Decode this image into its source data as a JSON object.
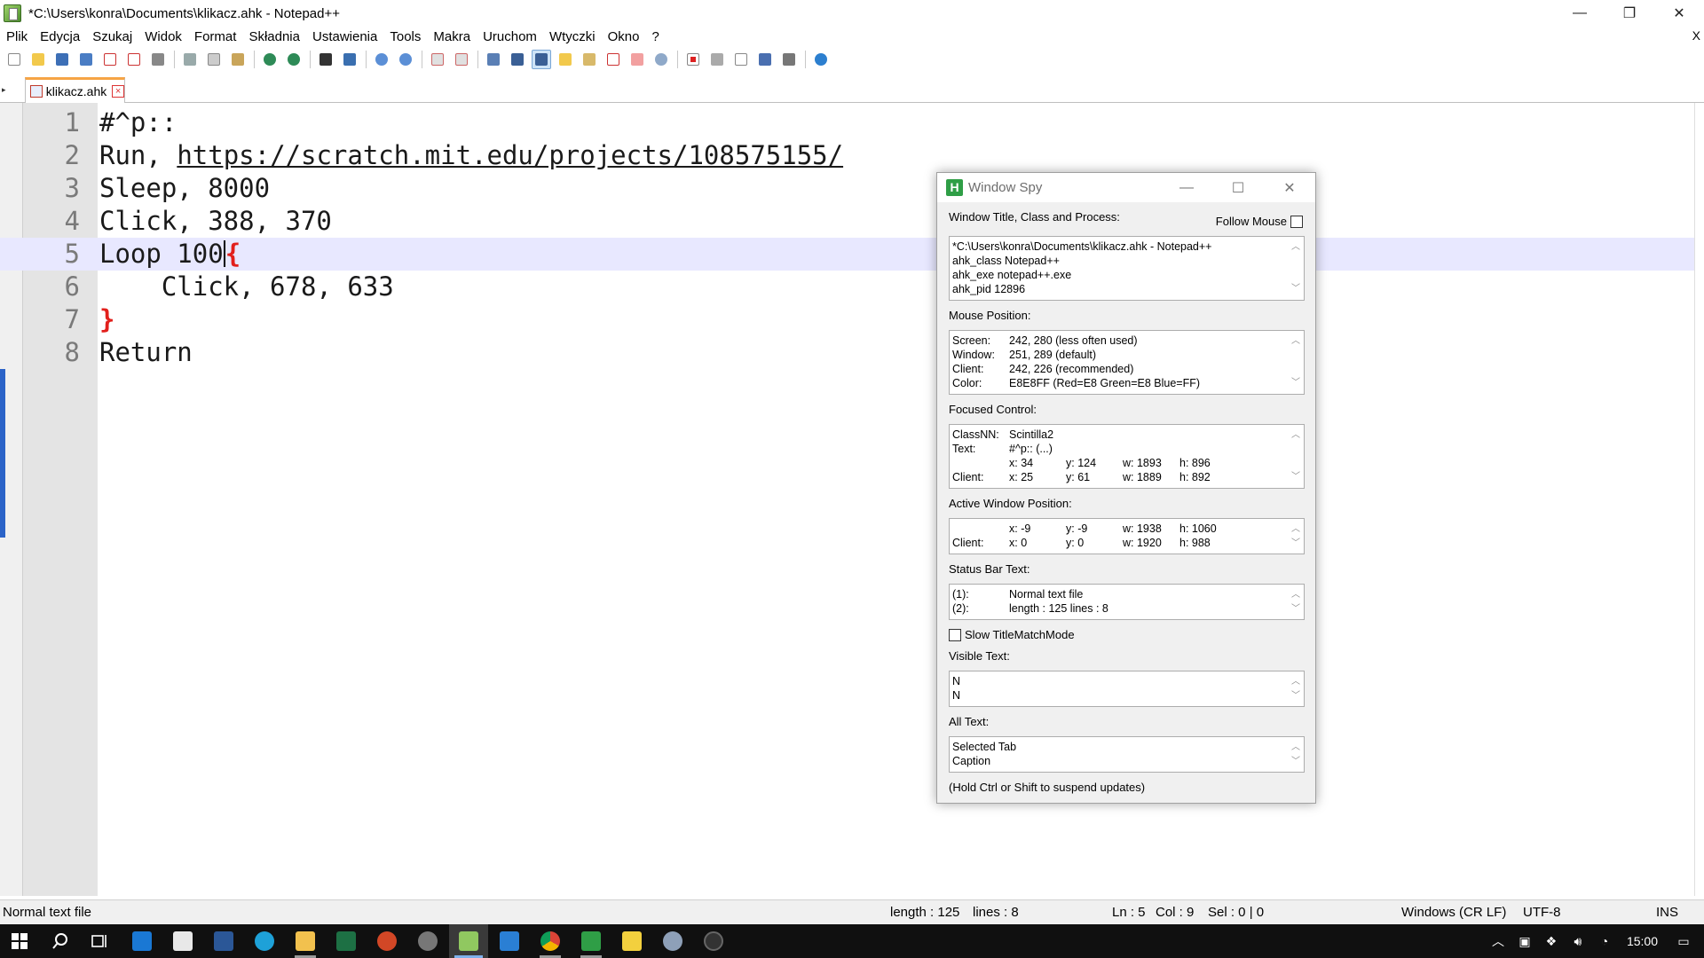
{
  "window": {
    "title": "*C:\\Users\\konra\\Documents\\klikacz.ahk - Notepad++",
    "controls": [
      "—",
      "❐",
      "✕"
    ]
  },
  "menu": {
    "items": [
      "Plik",
      "Edycja",
      "Szukaj",
      "Widok",
      "Format",
      "Składnia",
      "Ustawienia",
      "Tools",
      "Makra",
      "Uruchom",
      "Wtyczki",
      "Okno",
      "?"
    ],
    "close": "X"
  },
  "tab": {
    "label": "klikacz.ahk",
    "close": "×"
  },
  "editor": {
    "lines": [
      {
        "num": "1",
        "text": "#^p::"
      },
      {
        "num": "2",
        "prefix": "Run, ",
        "url": "https://scratch.mit.edu/projects/108575155/"
      },
      {
        "num": "3",
        "text": "Sleep, 8000"
      },
      {
        "num": "4",
        "text": "Click, 388, 370"
      },
      {
        "num": "5",
        "text": "Loop 100",
        "brace": "{"
      },
      {
        "num": "6",
        "text": "    Click, 678, 633"
      },
      {
        "num": "7",
        "brace": "}"
      },
      {
        "num": "8",
        "text": "Return"
      }
    ],
    "current_line": 5
  },
  "statusbar": {
    "filetype": "Normal text file",
    "length": "length : 125",
    "lines": "lines : 8",
    "ln": "Ln : 5",
    "col": "Col : 9",
    "sel": "Sel : 0 | 0",
    "eol": "Windows (CR LF)",
    "encoding": "UTF-8",
    "mode": "INS"
  },
  "spy": {
    "title": "Window Spy",
    "icon_letter": "H",
    "follow_mouse": "Follow Mouse",
    "sections": {
      "window_title": "Window Title, Class and Process:",
      "mouse_position": "Mouse Position:",
      "focused_control": "Focused Control:",
      "active_window": "Active Window Position:",
      "status_bar": "Status Bar Text:",
      "visible_text": "Visible Text:",
      "all_text": "All Text:"
    },
    "window_info": [
      "*C:\\Users\\konra\\Documents\\klikacz.ahk - Notepad++",
      "ahk_class Notepad++",
      "ahk_exe notepad++.exe",
      "ahk_pid 12896"
    ],
    "mouse": {
      "screen_label": "Screen:",
      "screen": "242, 280 (less often used)",
      "window_label": "Window:",
      "window": "251, 289 (default)",
      "client_label": "Client:",
      "client": "242, 226 (recommended)",
      "color_label": "Color:",
      "color": "E8E8FF (Red=E8 Green=E8 Blue=FF)"
    },
    "focused": {
      "classnn_label": "ClassNN:",
      "classnn": "Scintilla2",
      "text_label": "Text:",
      "text": "#^p:: (...)",
      "x": "x: 34",
      "y": "y: 124",
      "w": "w: 1893",
      "h": "h: 896",
      "client_label": "Client:",
      "cx": "x: 25",
      "cy": "y: 61",
      "cw": "w: 1889",
      "ch": "h: 892"
    },
    "active": {
      "x": "x: -9",
      "y": "y: -9",
      "w": "w: 1938",
      "h": "h: 1060",
      "client_label": "Client:",
      "cx": "x: 0",
      "cy": "y: 0",
      "cw": "w: 1920",
      "ch": "h: 988"
    },
    "statusbar_text": {
      "r1_label": "(1):",
      "r1": "Normal text file",
      "r2_label": "(2):",
      "r2": "length : 125    lines : 8"
    },
    "slow_title": "Slow TitleMatchMode",
    "visible_text": [
      "N",
      "N"
    ],
    "all_text": [
      "Selected Tab",
      "Caption"
    ],
    "hint": "(Hold Ctrl or Shift to suspend updates)"
  },
  "taskbar": {
    "clock": "15:00"
  }
}
